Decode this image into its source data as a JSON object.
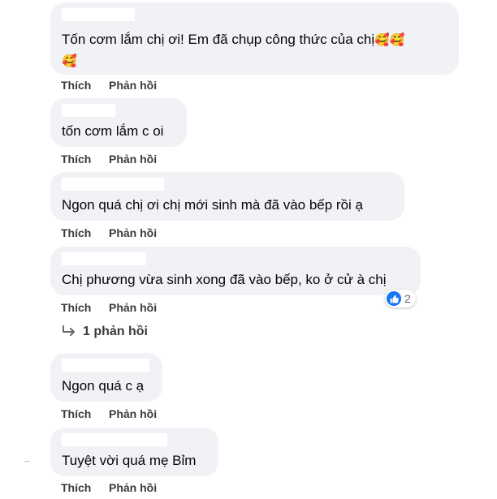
{
  "comments": [
    {
      "text_line1": "Tốn cơm lắm chị ơi! Em đã chụp công thức của chị",
      "text_line2": "",
      "like": "Thích",
      "reply": "Phản hồi"
    },
    {
      "text": "tốn cơm lắm c oi",
      "like": "Thích",
      "reply": "Phản hồi"
    },
    {
      "text": "Ngon quá chị ơi chị mới sinh mà đã vào bếp rồi ạ",
      "like": "Thích",
      "reply": "Phản hồi"
    },
    {
      "text": "Chị phương vừa sinh xong đã vào bếp, ko ở cử à chị",
      "like": "Thích",
      "reply": "Phản hồi",
      "reaction_count": "2"
    },
    {
      "text": "Ngon quá c ạ",
      "like": "Thích",
      "reply": "Phản hồi"
    },
    {
      "text": "Tuyệt vời quá mẹ Bỉm",
      "like": "Thích",
      "reply": "Phản hồi"
    }
  ],
  "replies_link": "1 phản hồi",
  "emoji_name": "smiling-face-with-hearts-icon",
  "colors": {
    "bubble": "#f0f2f5",
    "action_text": "#3a3b3c",
    "like_blue": "#1877f2"
  }
}
